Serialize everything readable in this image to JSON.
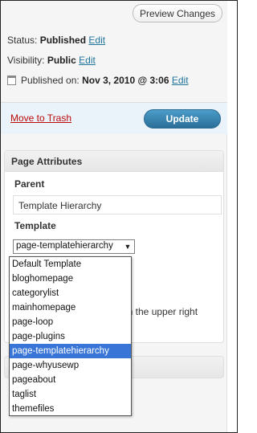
{
  "publish": {
    "preview_label": "Preview Changes",
    "status_label": "Status:",
    "status_value": "Published",
    "status_edit": "Edit",
    "visibility_label": "Visibility:",
    "visibility_value": "Public",
    "visibility_edit": "Edit",
    "published_label": "Published on:",
    "published_value": "Nov 3, 2010 @ 3:06",
    "published_edit": "Edit",
    "trash_label": "Move to Trash",
    "update_label": "Update"
  },
  "attributes": {
    "title": "Page Attributes",
    "parent_label": "Parent",
    "parent_value": "Template Hierarchy",
    "template_label": "Template",
    "template_value": "page-templatehierarchy",
    "behind_text": "in the upper right"
  },
  "template_options": [
    "Default Template",
    "bloghomepage",
    "categorylist",
    "mainhomepage",
    "page-loop",
    "page-plugins",
    "page-templatehierarchy",
    "page-whyusewp",
    "pageabout",
    "taglist",
    "themefiles"
  ],
  "selected_template": "page-templatehierarchy",
  "colors": {
    "link": "#21759b",
    "trash": "#bc0b0b",
    "update": "#2a6e98",
    "selection": "#3875d7"
  }
}
